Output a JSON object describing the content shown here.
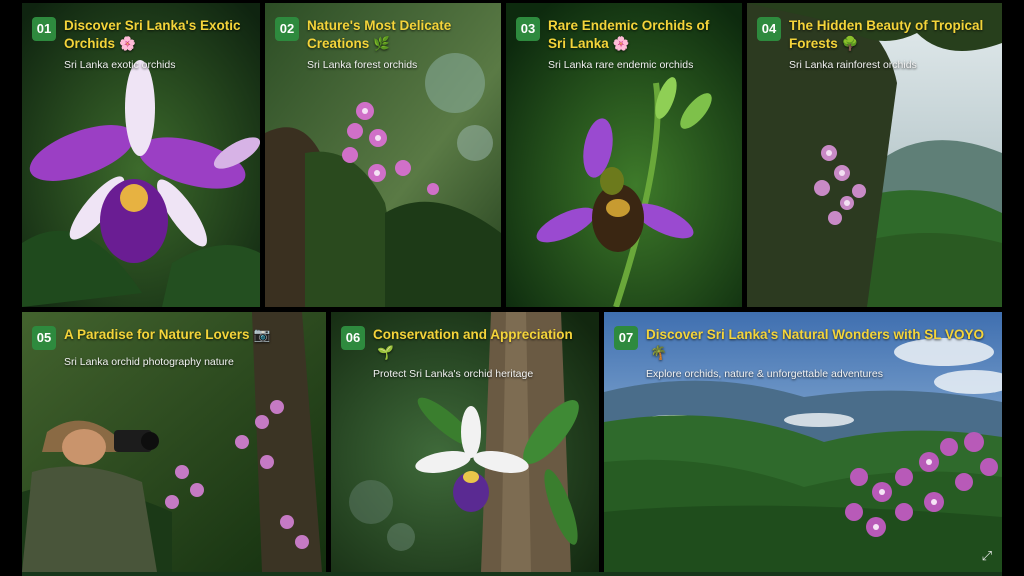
{
  "panels": [
    {
      "num": "01",
      "title": "Discover Sri Lanka's Exotic Orchids",
      "emoji": "🌸",
      "subtitle": "Sri Lanka exotic orchids"
    },
    {
      "num": "02",
      "title": "Nature's Most Delicate Creations",
      "emoji": "🌿",
      "subtitle": "Sri Lanka forest orchids"
    },
    {
      "num": "03",
      "title": "Rare Endemic Orchids of Sri Lanka",
      "emoji": "🌸",
      "subtitle": "Sri Lanka rare endemic orchids"
    },
    {
      "num": "04",
      "title": "The Hidden Beauty of Tropical Forests",
      "emoji": "🌳",
      "subtitle": "Sri Lanka rainforest orchids"
    },
    {
      "num": "05",
      "title": "A Paradise for Nature Lovers",
      "emoji": "📷",
      "subtitle": "Sri Lanka orchid photography nature"
    },
    {
      "num": "06",
      "title": "Conservation and Appreciation",
      "emoji": "🌱",
      "subtitle": "Protect Sri Lanka's orchid heritage"
    },
    {
      "num": "07",
      "title": "Discover Sri Lanka's Natural Wonders with SL VOYO",
      "emoji": "🌴",
      "subtitle": "Explore orchids, nature & unforgettable adventures"
    }
  ],
  "icons": {
    "expand": "expand-arrows-icon"
  },
  "colors": {
    "badge": "#2e8a3e",
    "title": "#f4d43a",
    "subtitle": "#f2f2f2",
    "background": "#000000"
  }
}
